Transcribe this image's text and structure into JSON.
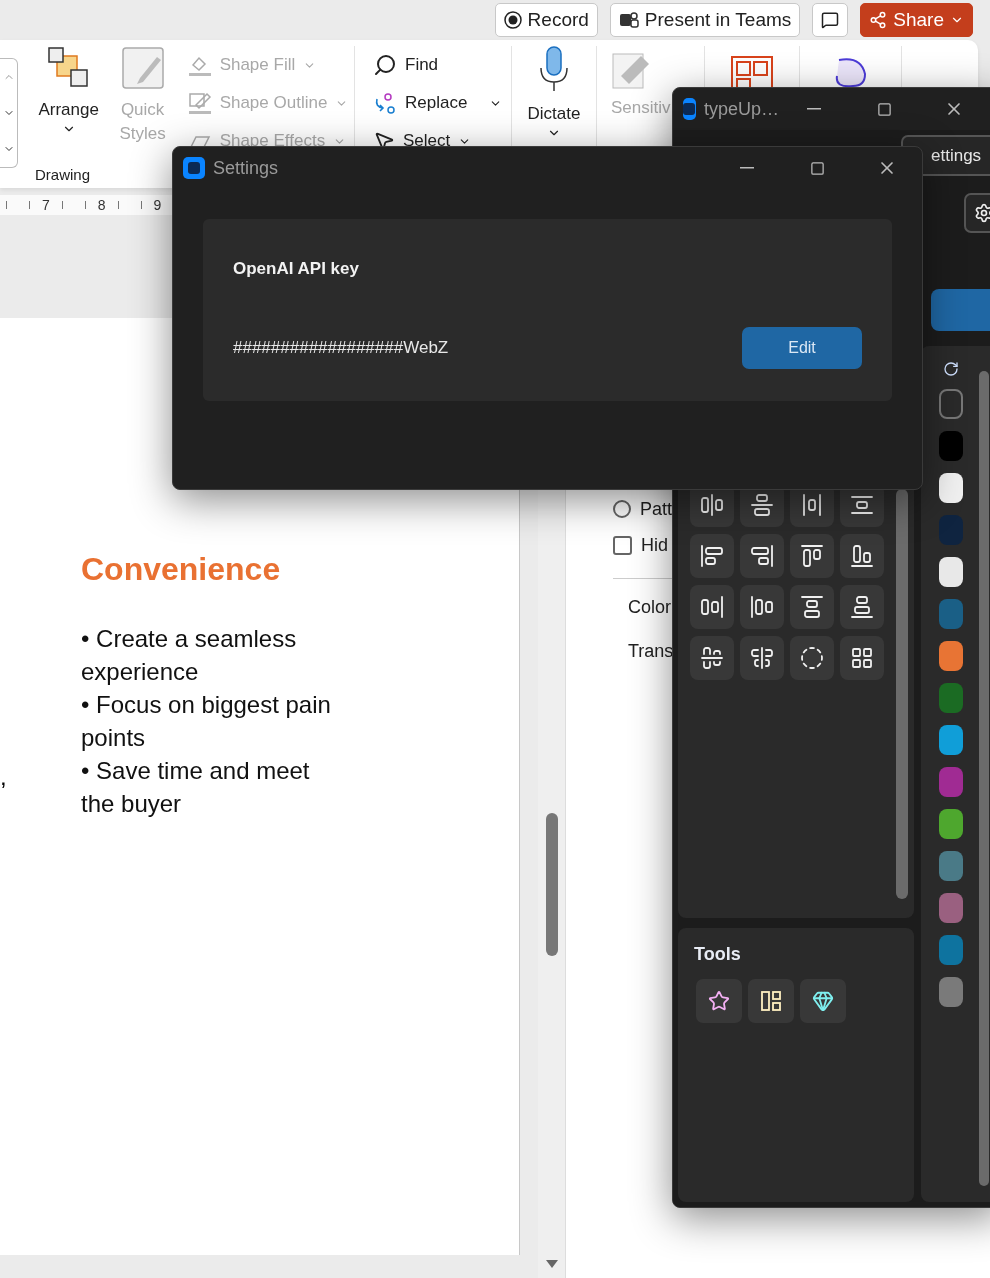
{
  "app_bar": {
    "record": "Record",
    "present": "Present in Teams",
    "share": "Share"
  },
  "ribbon": {
    "commands": [
      {
        "kind": "arrange",
        "label": "Arrange",
        "disabled": false
      },
      {
        "kind": "quick_styles",
        "label": "Quick Styles",
        "disabled": true
      }
    ],
    "shape_commands": [
      {
        "kind": "fill",
        "label": "Shape Fill",
        "disabled": true
      },
      {
        "kind": "outline",
        "label": "Shape Outline",
        "disabled": true
      },
      {
        "kind": "effects",
        "label": "Shape Effects",
        "disabled": true
      }
    ],
    "group_label": "Drawing",
    "editing": [
      {
        "kind": "find",
        "label": "Find"
      },
      {
        "kind": "replace",
        "label": "Replace"
      },
      {
        "kind": "select",
        "label": "Select"
      }
    ],
    "dictate": {
      "label": "Dictate",
      "disabled": false
    },
    "sensitivity": {
      "label": "Sensitiv",
      "disabled": true
    }
  },
  "ruler": [
    "7",
    "8",
    "9"
  ],
  "slide": {
    "edge_text": ",",
    "title": "Convenience",
    "bullets": [
      "• Create a seamless experience",
      "• Focus on biggest pain points",
      "• Save time and meet the buyer"
    ]
  },
  "format_pane": {
    "options": [
      {
        "kind": "radio",
        "label": "Patt",
        "checked": false
      },
      {
        "kind": "checkbox",
        "label": "Hid",
        "checked": false
      }
    ],
    "fields": [
      "Color",
      "Trans"
    ]
  },
  "typeup": {
    "title": "typeUp…",
    "settings_button": "ettings",
    "swatches": [
      {
        "color": "#000000"
      },
      {
        "color": "#f0f0f0"
      },
      {
        "color": "#0f2440"
      },
      {
        "color": "#e8e8e8"
      },
      {
        "color": "#1a5f86"
      },
      {
        "color": "#e87434"
      },
      {
        "color": "#1b6b23"
      },
      {
        "color": "#109ed8"
      },
      {
        "color": "#a02b93"
      },
      {
        "color": "#4ea72e"
      },
      {
        "color": "#4a7a87"
      },
      {
        "color": "#9a6080"
      },
      {
        "color": "#0e739f"
      },
      {
        "color": "#7a7a7a"
      }
    ],
    "tools_title": "Tools"
  },
  "settings_dialog": {
    "title": "Settings",
    "field_label": "OpenAI API key",
    "value": "##################WebZ",
    "button": "Edit"
  }
}
